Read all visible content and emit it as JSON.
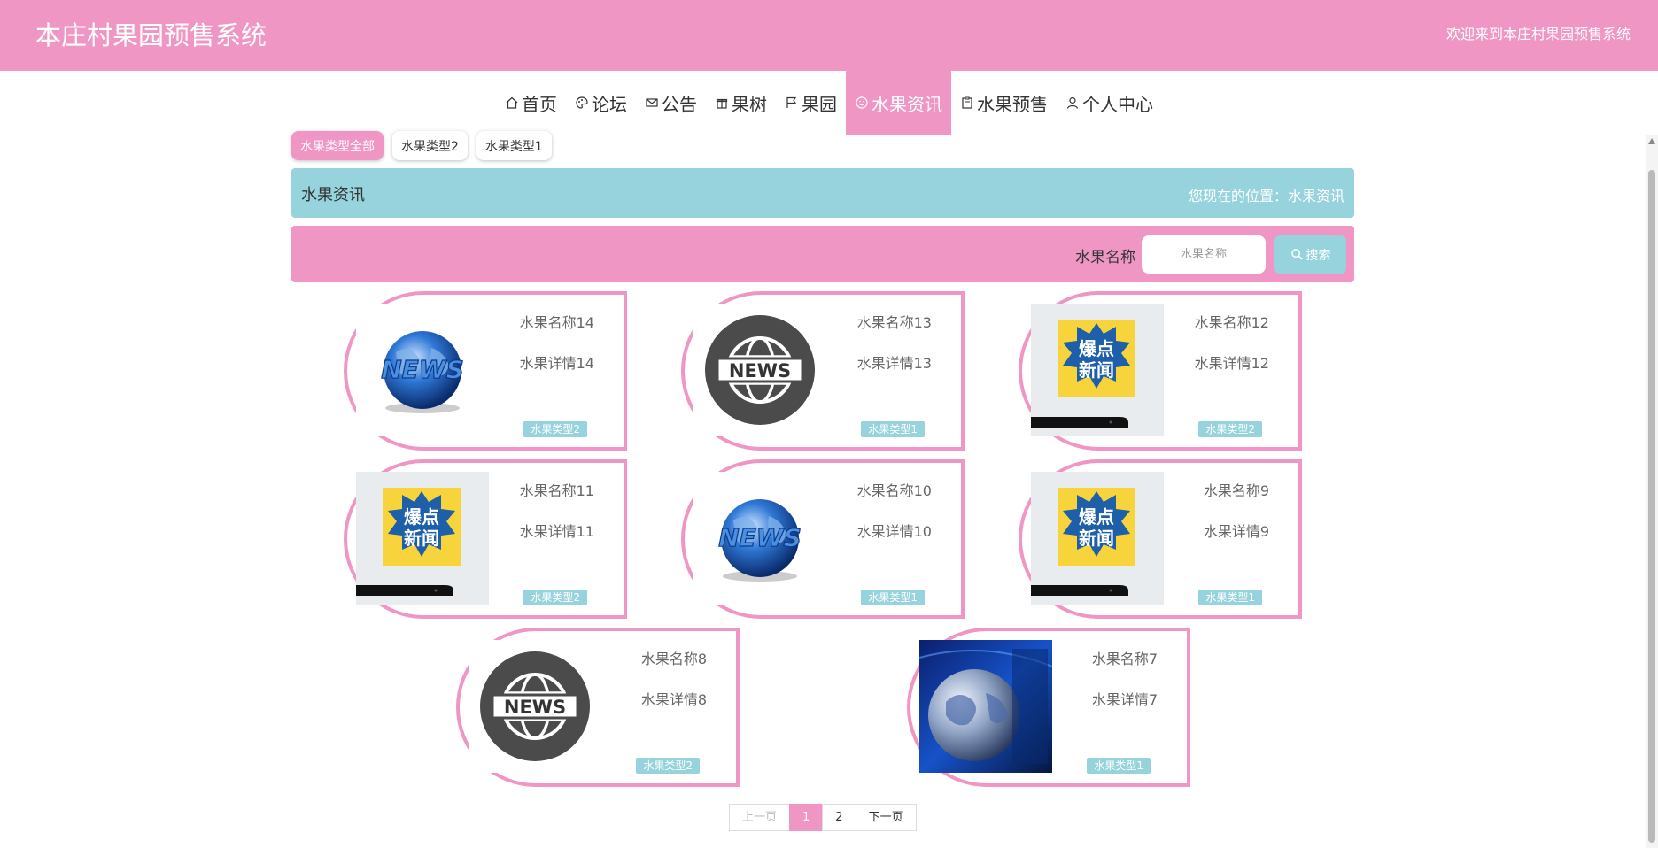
{
  "header": {
    "title": "本庄村果园预售系统",
    "welcome": "欢迎来到本庄村果园预售系统"
  },
  "nav": [
    {
      "label": "首页",
      "icon": "home-icon"
    },
    {
      "label": "论坛",
      "icon": "palette-icon"
    },
    {
      "label": "公告",
      "icon": "mail-icon"
    },
    {
      "label": "果树",
      "icon": "gift-icon"
    },
    {
      "label": "果园",
      "icon": "flag-icon"
    },
    {
      "label": "水果资讯",
      "icon": "smile-icon",
      "active": true
    },
    {
      "label": "水果预售",
      "icon": "clipboard-icon"
    },
    {
      "label": "个人中心",
      "icon": "user-icon"
    }
  ],
  "filters": [
    {
      "label": "水果类型全部",
      "active": true
    },
    {
      "label": "水果类型2"
    },
    {
      "label": "水果类型1"
    }
  ],
  "breadcrumb": {
    "title": "水果资讯",
    "location": "您现在的位置：水果资讯"
  },
  "search": {
    "label": "水果名称",
    "placeholder": "水果名称",
    "button": "搜索"
  },
  "cards": [
    {
      "name": "水果名称14",
      "detail": "水果详情14",
      "type": "水果类型2",
      "image": "news-globe"
    },
    {
      "name": "水果名称13",
      "detail": "水果详情13",
      "type": "水果类型1",
      "image": "news-circle"
    },
    {
      "name": "水果名称12",
      "detail": "水果详情12",
      "type": "水果类型2",
      "image": "hot-news-phone"
    },
    {
      "name": "水果名称11",
      "detail": "水果详情11",
      "type": "水果类型2",
      "image": "hot-news-phone"
    },
    {
      "name": "水果名称10",
      "detail": "水果详情10",
      "type": "水果类型1",
      "image": "news-globe"
    },
    {
      "name": "水果名称9",
      "detail": "水果详情9",
      "type": "水果类型1",
      "image": "hot-news-phone"
    },
    {
      "name": "水果名称8",
      "detail": "水果详情8",
      "type": "水果类型2",
      "image": "news-circle"
    },
    {
      "name": "水果名称7",
      "detail": "水果详情7",
      "type": "水果类型1",
      "image": "blue-globe-broadcast"
    }
  ],
  "hot_news_badge": "爆点新闻",
  "news_badge": "NEWS",
  "pagination": {
    "prev": "上一页",
    "pages": [
      "1",
      "2"
    ],
    "current": "1",
    "next": "下一页"
  },
  "colors": {
    "primary_pink": "#ef96c4",
    "accent_teal": "#96d3dc"
  }
}
